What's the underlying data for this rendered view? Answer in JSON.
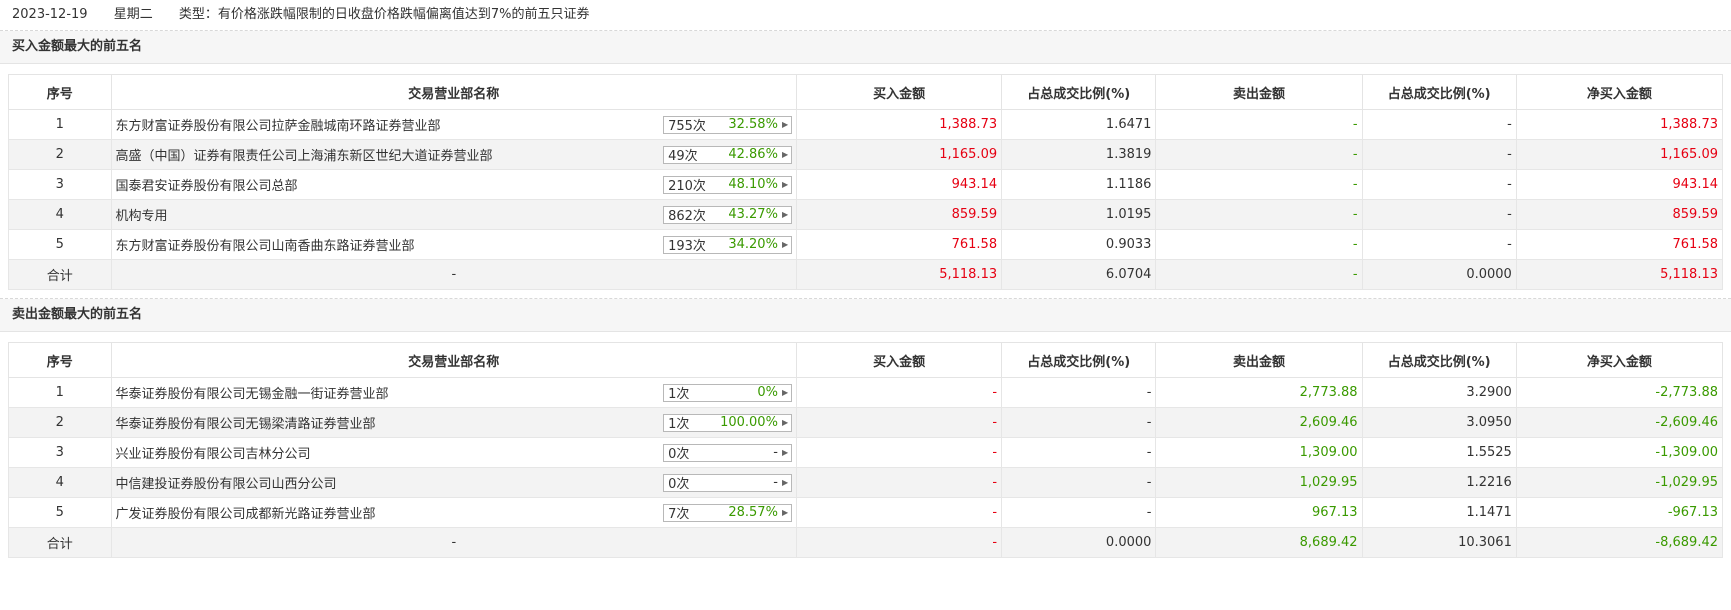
{
  "header": {
    "date": "2023-12-19",
    "weekday": "星期二",
    "type_text": "类型：有价格涨跌幅限制的日收盘价格跌幅偏离值达到7%的前五只证券"
  },
  "columns": [
    "序号",
    "交易营业部名称",
    "买入金额",
    "占总成交比例(%)",
    "卖出金额",
    "占总成交比例(%)",
    "净买入金额"
  ],
  "buy_section": {
    "title": "买入金额最大的前五名",
    "rows": [
      {
        "no": "1",
        "name": "东方财富证券股份有限公司拉萨金融城南环路证券营业部",
        "count": "755次",
        "pct": "32.58%",
        "buy": "1,388.73",
        "buy_ratio": "1.6471",
        "sell": "-",
        "sell_ratio": "-",
        "net": "1,388.73"
      },
      {
        "no": "2",
        "name": "高盛（中国）证券有限责任公司上海浦东新区世纪大道证券营业部",
        "count": "49次",
        "pct": "42.86%",
        "buy": "1,165.09",
        "buy_ratio": "1.3819",
        "sell": "-",
        "sell_ratio": "-",
        "net": "1,165.09"
      },
      {
        "no": "3",
        "name": "国泰君安证券股份有限公司总部",
        "count": "210次",
        "pct": "48.10%",
        "buy": "943.14",
        "buy_ratio": "1.1186",
        "sell": "-",
        "sell_ratio": "-",
        "net": "943.14"
      },
      {
        "no": "4",
        "name": "机构专用",
        "count": "862次",
        "pct": "43.27%",
        "buy": "859.59",
        "buy_ratio": "1.0195",
        "sell": "-",
        "sell_ratio": "-",
        "net": "859.59"
      },
      {
        "no": "5",
        "name": "东方财富证券股份有限公司山南香曲东路证券营业部",
        "count": "193次",
        "pct": "34.20%",
        "buy": "761.58",
        "buy_ratio": "0.9033",
        "sell": "-",
        "sell_ratio": "-",
        "net": "761.58"
      }
    ],
    "total": {
      "label": "合计",
      "name": "-",
      "buy": "5,118.13",
      "buy_ratio": "6.0704",
      "sell": "-",
      "sell_ratio": "0.0000",
      "net": "5,118.13"
    }
  },
  "sell_section": {
    "title": "卖出金额最大的前五名",
    "rows": [
      {
        "no": "1",
        "name": "华泰证券股份有限公司无锡金融一街证券营业部",
        "count": "1次",
        "pct": "0%",
        "buy": "-",
        "buy_ratio": "-",
        "sell": "2,773.88",
        "sell_ratio": "3.2900",
        "net": "-2,773.88"
      },
      {
        "no": "2",
        "name": "华泰证券股份有限公司无锡梁清路证券营业部",
        "count": "1次",
        "pct": "100.00%",
        "buy": "-",
        "buy_ratio": "-",
        "sell": "2,609.46",
        "sell_ratio": "3.0950",
        "net": "-2,609.46"
      },
      {
        "no": "3",
        "name": "兴业证券股份有限公司吉林分公司",
        "count": "0次",
        "pct": "-",
        "buy": "-",
        "buy_ratio": "-",
        "sell": "1,309.00",
        "sell_ratio": "1.5525",
        "net": "-1,309.00"
      },
      {
        "no": "4",
        "name": "中信建投证券股份有限公司山西分公司",
        "count": "0次",
        "pct": "-",
        "buy": "-",
        "buy_ratio": "-",
        "sell": "1,029.95",
        "sell_ratio": "1.2216",
        "net": "-1,029.95"
      },
      {
        "no": "5",
        "name": "广发证券股份有限公司成都新光路证券营业部",
        "count": "7次",
        "pct": "28.57%",
        "buy": "-",
        "buy_ratio": "-",
        "sell": "967.13",
        "sell_ratio": "1.1471",
        "net": "-967.13"
      }
    ],
    "total": {
      "label": "合计",
      "name": "-",
      "buy": "-",
      "buy_ratio": "0.0000",
      "sell": "8,689.42",
      "sell_ratio": "10.3061",
      "net": "-8,689.42"
    }
  },
  "colors": {
    "up": "#e60012",
    "down": "#3a9a00"
  }
}
